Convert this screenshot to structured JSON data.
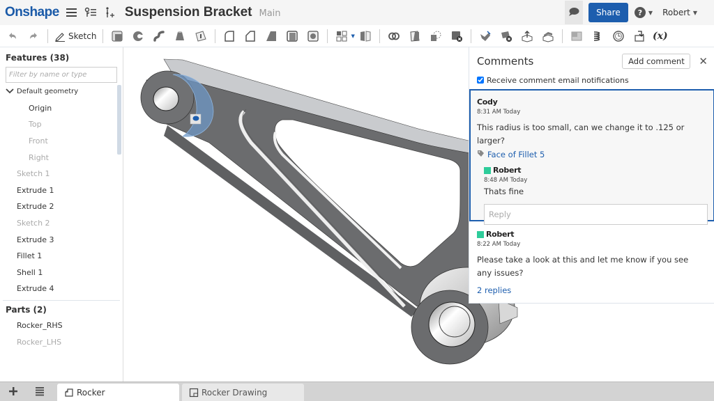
{
  "app": {
    "brand": "Onshape",
    "document_title": "Suspension Bracket",
    "branch": "Main",
    "share_label": "Share",
    "help_label": "?",
    "user_name": "Robert",
    "icons": [
      "menu-icon",
      "version-graph-icon",
      "insert-icon",
      "comment-icon",
      "help-icon"
    ]
  },
  "toolbar": {
    "sketch_label": "Sketch",
    "variable_label": "(x)",
    "tools": [
      "undo",
      "redo",
      "sketch",
      "extrude",
      "revolve",
      "sweep",
      "loft",
      "thicken",
      "fillet",
      "chamfer",
      "draft",
      "shell",
      "hole",
      "pattern",
      "mirror",
      "boolean",
      "split",
      "transform",
      "delete-part",
      "modify-fillet",
      "delete-face",
      "move-face",
      "replace-face",
      "plane",
      "helix",
      "mate-connector",
      "import",
      "variable"
    ]
  },
  "features": {
    "title": "Features (38)",
    "filter_placeholder": "Filter by name or type",
    "default_geometry_label": "Default geometry",
    "default_geometry": [
      {
        "label": "Origin",
        "dim": false
      },
      {
        "label": "Top",
        "dim": true
      },
      {
        "label": "Front",
        "dim": true
      },
      {
        "label": "Right",
        "dim": true
      }
    ],
    "items": [
      {
        "label": "Sketch 1",
        "dim": true
      },
      {
        "label": "Extrude 1",
        "dim": false
      },
      {
        "label": "Extrude 2",
        "dim": false
      },
      {
        "label": "Sketch 2",
        "dim": true
      },
      {
        "label": "Extrude 3",
        "dim": false
      },
      {
        "label": "Fillet 1",
        "dim": false
      },
      {
        "label": "Shell 1",
        "dim": false
      },
      {
        "label": "Extrude 4",
        "dim": false
      }
    ]
  },
  "parts": {
    "title": "Parts (2)",
    "items": [
      {
        "label": "Rocker_RHS",
        "dim": false
      },
      {
        "label": "Rocker_LHS",
        "dim": true
      }
    ]
  },
  "comments": {
    "title": "Comments",
    "add_label": "Add comment",
    "close_label": "✕",
    "notify_label": "Receive comment email notifications",
    "notify_checked": true,
    "threads": [
      {
        "author": "Cody",
        "time": "8:31 AM Today",
        "text": "This radius is too small, can we change it to .125 or larger?",
        "tag": "Face of Fillet 5",
        "reply": {
          "author": "Robert",
          "time": "8:48 AM Today",
          "text": "Thats fine",
          "swatch": "#2ecc9a"
        },
        "reply_placeholder": "Reply"
      },
      {
        "author": "Robert",
        "swatch": "#2ecc9a",
        "time": "8:22 AM Today",
        "text": "Please take a look at this and let me know if you see any issues?",
        "replies_label": "2 replies"
      }
    ]
  },
  "tabs": [
    {
      "label": "Rocker",
      "active": true,
      "icon": "part-studio-icon"
    },
    {
      "label": "Rocker Drawing",
      "active": false,
      "icon": "drawing-icon"
    }
  ],
  "colors": {
    "brand": "#1a5aa8",
    "accent": "#1d5eae",
    "author_swatch": "#2ecc9a",
    "model_gray": "#6b6c6e"
  }
}
